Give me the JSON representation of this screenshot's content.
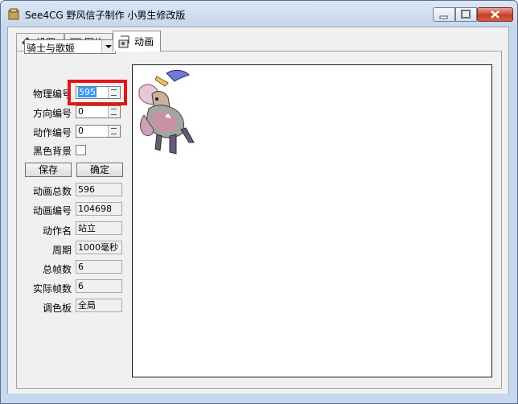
{
  "window": {
    "title": "See4CG 野风信子制作  小男生修改版"
  },
  "tabs": [
    {
      "label": "设置",
      "icon": "settings-diamond-icon"
    },
    {
      "label": "图片",
      "icon": "picture-icon"
    },
    {
      "label": "动画",
      "icon": "animation-icon",
      "selected": true
    }
  ],
  "character_select": {
    "value": "骑士与歌姬"
  },
  "fields": {
    "physical_no": {
      "label": "物理编号",
      "value": "595"
    },
    "direction_no": {
      "label": "方向编号",
      "value": "0"
    },
    "action_no": {
      "label": "动作编号",
      "value": "0"
    },
    "black_bg": {
      "label": "黑色背景",
      "checked": false
    }
  },
  "buttons": {
    "save": "保存",
    "confirm": "确定"
  },
  "info": {
    "total_anim": {
      "label": "动画总数",
      "value": "596"
    },
    "anim_no": {
      "label": "动画编号",
      "value": "104698"
    },
    "action_name": {
      "label": "动作名",
      "value": "站立"
    },
    "period": {
      "label": "周期",
      "value": "1000毫秒"
    },
    "total_frames": {
      "label": "总帧数",
      "value": "6"
    },
    "actual_frames": {
      "label": "实际帧数",
      "value": "6"
    },
    "palette": {
      "label": "调色板",
      "value": "全局"
    }
  },
  "colors": {
    "highlight": "#e31515",
    "selection": "#3399ff",
    "window_frame": "#c8d8ec"
  }
}
